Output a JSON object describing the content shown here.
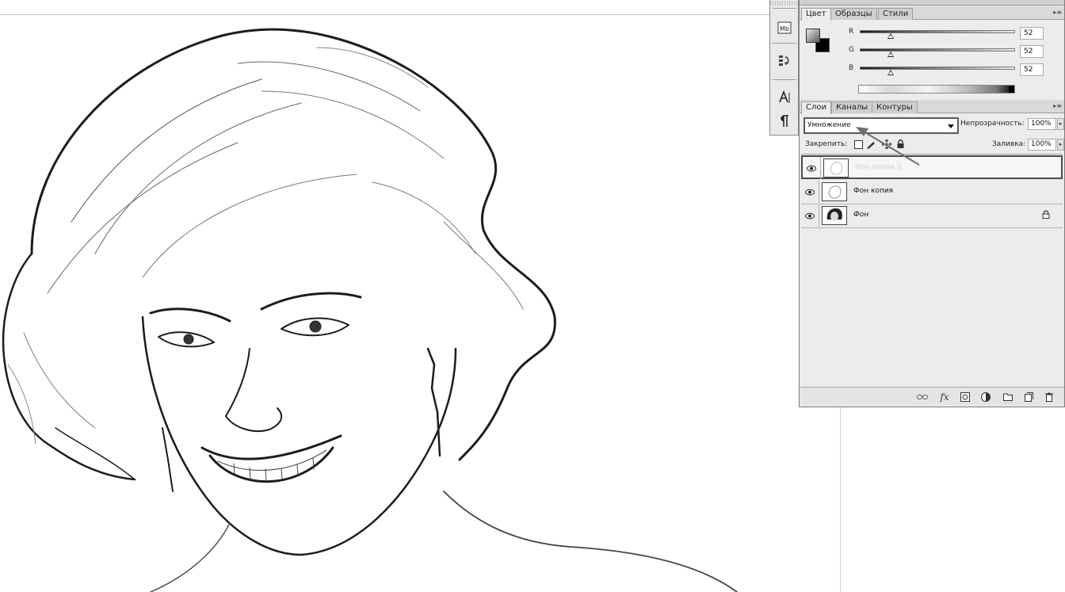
{
  "canvas": {
    "description_icon": "portrait-pencil-sketch"
  },
  "dock": {
    "items": [
      {
        "icon": "text-box-icon",
        "glyph": "Ⓐ"
      },
      {
        "icon": "history-icon",
        "glyph": "↺"
      },
      {
        "icon": "character-icon",
        "glyph": "A|"
      },
      {
        "icon": "paragraph-icon",
        "glyph": "¶"
      }
    ]
  },
  "color_panel": {
    "tabs": [
      "Цвет",
      "Образцы",
      "Стили"
    ],
    "active_tab": "Цвет",
    "channels": [
      {
        "label": "R",
        "value": "52"
      },
      {
        "label": "G",
        "value": "52"
      },
      {
        "label": "B",
        "value": "52"
      }
    ]
  },
  "layers_panel": {
    "tabs": [
      "Слои",
      "Каналы",
      "Контуры"
    ],
    "active_tab": "Слои",
    "blend_mode": "Умножение",
    "opacity_label": "Непрозрачность:",
    "opacity_value": "100%",
    "lock_label": "Закрепить:",
    "fill_label": "Заливка:",
    "fill_value": "100%",
    "layers": [
      {
        "name": "Фон копия 2",
        "selected": true,
        "visible": true,
        "thumb": "sketch"
      },
      {
        "name": "Фон копия",
        "selected": false,
        "visible": true,
        "thumb": "sketch"
      },
      {
        "name": "Фон",
        "selected": false,
        "visible": true,
        "thumb": "photo",
        "locked": true
      }
    ],
    "footer_icons": [
      "link-layers-icon",
      "fx-icon",
      "add-mask-icon",
      "adjustment-layer-icon",
      "new-group-icon",
      "new-layer-icon",
      "delete-layer-icon"
    ]
  },
  "colors": {
    "panel_bg": "#ececec",
    "accent_border": "#4a4a4a",
    "annotation_arrow": "#6e6e6e"
  }
}
